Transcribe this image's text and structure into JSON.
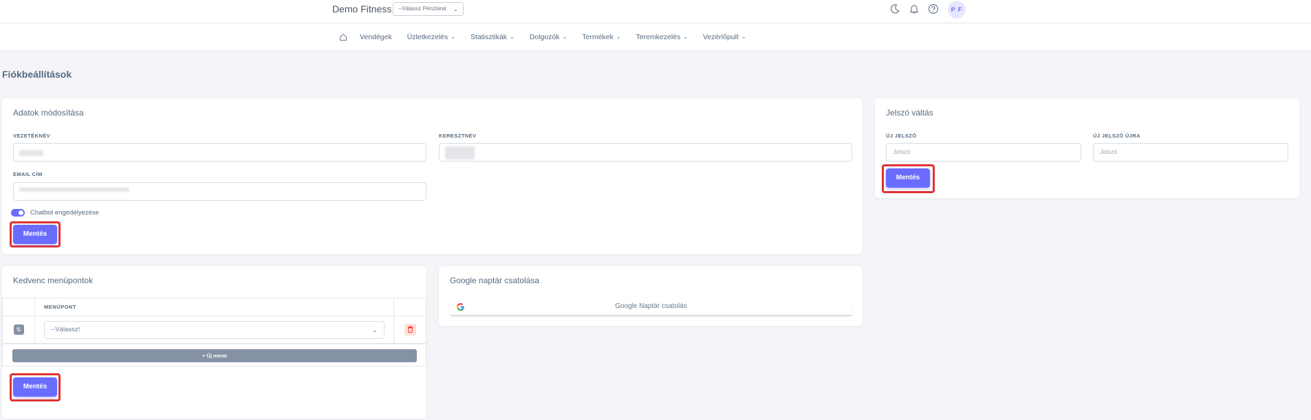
{
  "header": {
    "brand": "Demo Fitness",
    "register_select": "--Válassz Pénztárat",
    "avatar_initials": "P F"
  },
  "nav": {
    "items": [
      {
        "label": "Vendégek",
        "dropdown": false
      },
      {
        "label": "Üzletkezelés",
        "dropdown": true
      },
      {
        "label": "Statisztikák",
        "dropdown": true
      },
      {
        "label": "Dolgozók",
        "dropdown": true
      },
      {
        "label": "Termékek",
        "dropdown": true
      },
      {
        "label": "Teremkezelés",
        "dropdown": true
      },
      {
        "label": "Vezérlőpult",
        "dropdown": true
      }
    ]
  },
  "page": {
    "title": "Fiókbeállítások"
  },
  "profile_card": {
    "title": "Adatok módosítása",
    "lastname_label": "VEZETÉKNÉV",
    "firstname_label": "KERESZTNÉV",
    "email_label": "EMAIL CÍM",
    "chatbot_label": "Chatbot engedélyezése",
    "chatbot_enabled": true,
    "save_label": "Mentés"
  },
  "password_card": {
    "title": "Jelszó váltás",
    "new_password_label": "ÚJ JELSZÓ",
    "new_password_placeholder": "Jelszó",
    "repeat_password_label": "ÚJ JELSZÓ ÚJRA",
    "repeat_password_placeholder": "Jelszó",
    "save_label": "Mentés"
  },
  "favorites_card": {
    "title": "Kedvenc menüpontok",
    "column_header": "MENÜPONT",
    "select_value": "--Válassz!",
    "new_menu_label": "+ Új menü",
    "save_label": "Mentés"
  },
  "google_card": {
    "title": "Google naptár csatolása",
    "button_label": "Google Naptár csatolás"
  },
  "colors": {
    "primary": "#696cff",
    "highlight": "#e03131",
    "secondary": "#8592a3"
  }
}
